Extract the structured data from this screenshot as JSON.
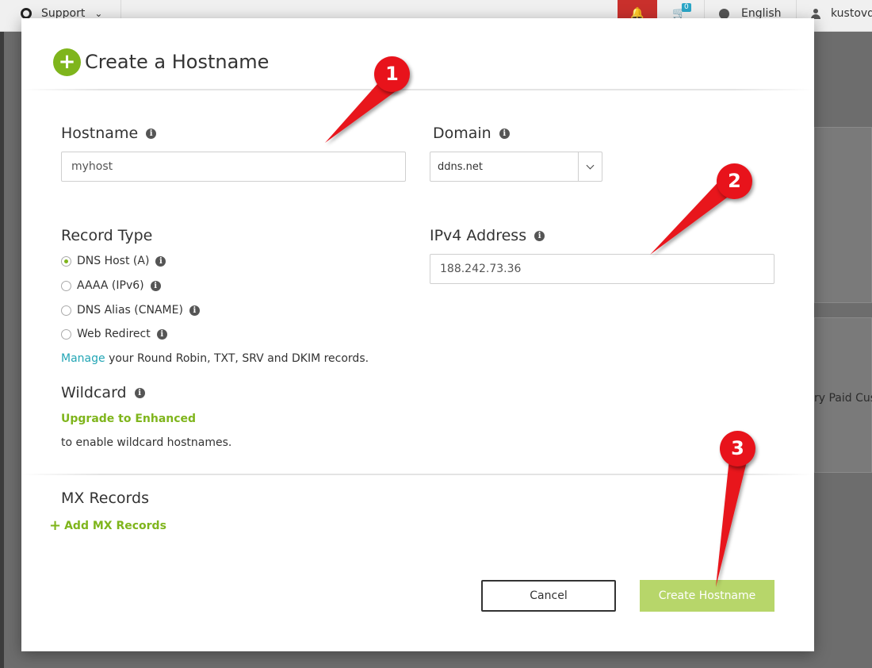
{
  "topbar": {
    "support_label": "Support",
    "cart_count": "0",
    "language": "English",
    "username": "kustovd",
    "icons": [
      "lifebuoy-icon",
      "chevron-down-icon",
      "bell-icon",
      "cart-icon",
      "globe-icon",
      "user-icon"
    ]
  },
  "background": {
    "partial_text": "ry Paid Cus"
  },
  "modal": {
    "title": "Create a Hostname",
    "hostname": {
      "label": "Hostname",
      "value": "myhost"
    },
    "domain": {
      "label": "Domain",
      "selected": "ddns.net"
    },
    "record_type": {
      "label": "Record Type",
      "options": [
        {
          "label": "DNS Host (A)",
          "checked": true
        },
        {
          "label": "AAAA (IPv6)",
          "checked": false
        },
        {
          "label": "DNS Alias (CNAME)",
          "checked": false
        },
        {
          "label": "Web Redirect",
          "checked": false
        }
      ],
      "manage_link": "Manage",
      "manage_text": " your Round Robin, TXT, SRV and DKIM records."
    },
    "ipv4": {
      "label": "IPv4 Address",
      "value": "188.242.73.36"
    },
    "wildcard": {
      "label": "Wildcard",
      "upgrade_link": "Upgrade to Enhanced",
      "note": "to enable wildcard hostnames."
    },
    "mx": {
      "label": "MX Records",
      "add_link": "Add MX Records"
    },
    "buttons": {
      "cancel": "Cancel",
      "create": "Create Hostname"
    }
  },
  "annotations": [
    "1",
    "2",
    "3"
  ],
  "colors": {
    "accent_green": "#7fb51c",
    "create_button": "#b7d66a",
    "link_teal": "#23a6b5",
    "annotation_red": "#e8131b",
    "bell_red": "#c9302c"
  }
}
